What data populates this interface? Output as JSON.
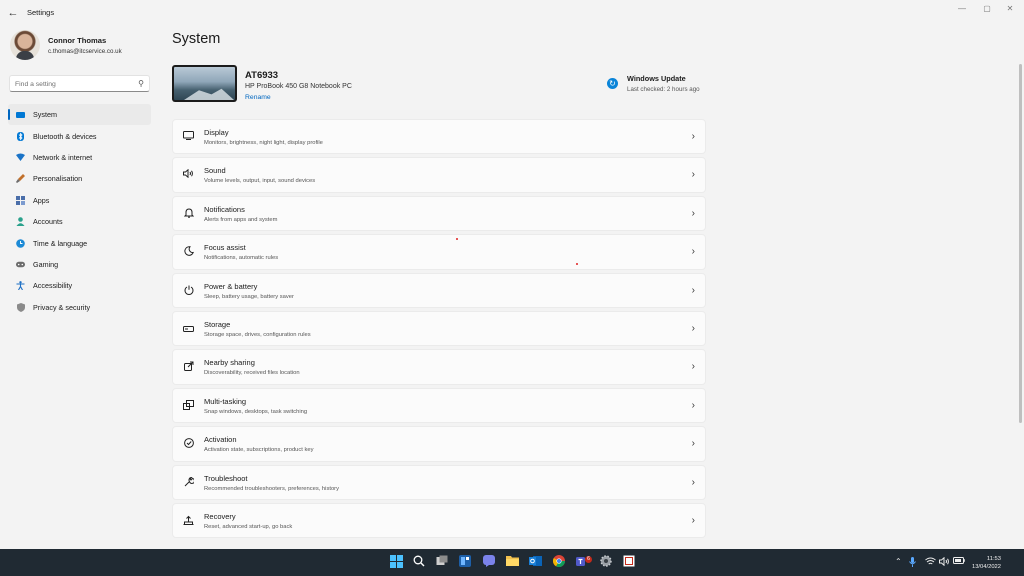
{
  "window": {
    "title": "Settings",
    "back_glyph": "←",
    "min_glyph": "—",
    "max_glyph": "▢",
    "close_glyph": "✕"
  },
  "profile": {
    "name": "Connor Thomas",
    "email": "c.thomas@itcservice.co.uk"
  },
  "search": {
    "placeholder": "Find a setting"
  },
  "sidebar": {
    "items": [
      {
        "label": "System",
        "icon": "monitor-icon",
        "color": "#0078d4",
        "active": true
      },
      {
        "label": "Bluetooth & devices",
        "icon": "bluetooth-icon",
        "color": "#0078d4"
      },
      {
        "label": "Network & internet",
        "icon": "wifi-icon",
        "color": "#1a73c7"
      },
      {
        "label": "Personalisation",
        "icon": "brush-icon",
        "color": "#c1702b"
      },
      {
        "label": "Apps",
        "icon": "apps-icon",
        "color": "#4a6ea9"
      },
      {
        "label": "Accounts",
        "icon": "person-icon",
        "color": "#2aa18c"
      },
      {
        "label": "Time & language",
        "icon": "globe-clock-icon",
        "color": "#1c8ad6"
      },
      {
        "label": "Gaming",
        "icon": "controller-icon",
        "color": "#6b6b6b"
      },
      {
        "label": "Accessibility",
        "icon": "accessibility-icon",
        "color": "#1c6fc4"
      },
      {
        "label": "Privacy & security",
        "icon": "shield-icon",
        "color": "#7a7a7a"
      }
    ]
  },
  "main": {
    "title": "System",
    "device": {
      "name": "AT6933",
      "model": "HP ProBook 450 G8 Notebook PC",
      "rename": "Rename"
    },
    "update": {
      "title": "Windows Update",
      "subtitle": "Last checked: 2 hours ago"
    },
    "cards": [
      {
        "title": "Display",
        "subtitle": "Monitors, brightness, night light, display profile",
        "icon": "display-icon"
      },
      {
        "title": "Sound",
        "subtitle": "Volume levels, output, input, sound devices",
        "icon": "speaker-icon"
      },
      {
        "title": "Notifications",
        "subtitle": "Alerts from apps and system",
        "icon": "bell-icon"
      },
      {
        "title": "Focus assist",
        "subtitle": "Notifications, automatic rules",
        "icon": "moon-icon"
      },
      {
        "title": "Power & battery",
        "subtitle": "Sleep, battery usage, battery saver",
        "icon": "power-icon"
      },
      {
        "title": "Storage",
        "subtitle": "Storage space, drives, configuration rules",
        "icon": "storage-icon"
      },
      {
        "title": "Nearby sharing",
        "subtitle": "Discoverability, received files location",
        "icon": "share-icon"
      },
      {
        "title": "Multi-tasking",
        "subtitle": "Snap windows, desktops, task switching",
        "icon": "multitask-icon"
      },
      {
        "title": "Activation",
        "subtitle": "Activation state, subscriptions, product key",
        "icon": "check-circle-icon"
      },
      {
        "title": "Troubleshoot",
        "subtitle": "Recommended troubleshooters, preferences, history",
        "icon": "wrench-icon"
      },
      {
        "title": "Recovery",
        "subtitle": "Reset, advanced start-up, go back",
        "icon": "recovery-icon"
      }
    ]
  },
  "taskbar": {
    "time": "11:53",
    "date": "13/04/2022",
    "teams_badge": "6"
  }
}
